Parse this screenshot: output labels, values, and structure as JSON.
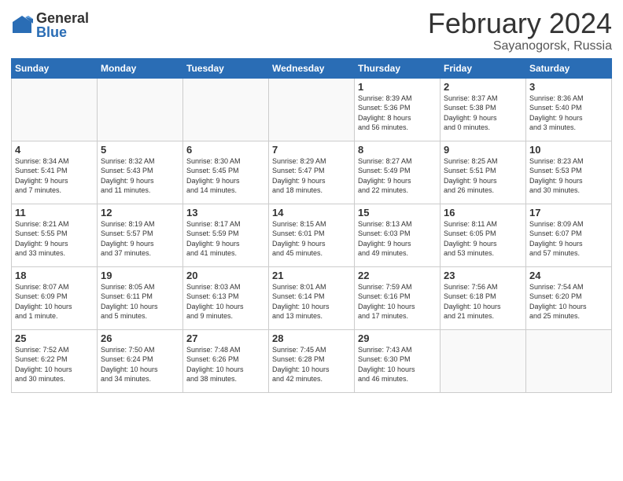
{
  "header": {
    "logo_general": "General",
    "logo_blue": "Blue",
    "title": "February 2024",
    "subtitle": "Sayanogorsk, Russia"
  },
  "days_of_week": [
    "Sunday",
    "Monday",
    "Tuesday",
    "Wednesday",
    "Thursday",
    "Friday",
    "Saturday"
  ],
  "weeks": [
    [
      {
        "day": "",
        "info": ""
      },
      {
        "day": "",
        "info": ""
      },
      {
        "day": "",
        "info": ""
      },
      {
        "day": "",
        "info": ""
      },
      {
        "day": "1",
        "info": "Sunrise: 8:39 AM\nSunset: 5:36 PM\nDaylight: 8 hours\nand 56 minutes."
      },
      {
        "day": "2",
        "info": "Sunrise: 8:37 AM\nSunset: 5:38 PM\nDaylight: 9 hours\nand 0 minutes."
      },
      {
        "day": "3",
        "info": "Sunrise: 8:36 AM\nSunset: 5:40 PM\nDaylight: 9 hours\nand 3 minutes."
      }
    ],
    [
      {
        "day": "4",
        "info": "Sunrise: 8:34 AM\nSunset: 5:41 PM\nDaylight: 9 hours\nand 7 minutes."
      },
      {
        "day": "5",
        "info": "Sunrise: 8:32 AM\nSunset: 5:43 PM\nDaylight: 9 hours\nand 11 minutes."
      },
      {
        "day": "6",
        "info": "Sunrise: 8:30 AM\nSunset: 5:45 PM\nDaylight: 9 hours\nand 14 minutes."
      },
      {
        "day": "7",
        "info": "Sunrise: 8:29 AM\nSunset: 5:47 PM\nDaylight: 9 hours\nand 18 minutes."
      },
      {
        "day": "8",
        "info": "Sunrise: 8:27 AM\nSunset: 5:49 PM\nDaylight: 9 hours\nand 22 minutes."
      },
      {
        "day": "9",
        "info": "Sunrise: 8:25 AM\nSunset: 5:51 PM\nDaylight: 9 hours\nand 26 minutes."
      },
      {
        "day": "10",
        "info": "Sunrise: 8:23 AM\nSunset: 5:53 PM\nDaylight: 9 hours\nand 30 minutes."
      }
    ],
    [
      {
        "day": "11",
        "info": "Sunrise: 8:21 AM\nSunset: 5:55 PM\nDaylight: 9 hours\nand 33 minutes."
      },
      {
        "day": "12",
        "info": "Sunrise: 8:19 AM\nSunset: 5:57 PM\nDaylight: 9 hours\nand 37 minutes."
      },
      {
        "day": "13",
        "info": "Sunrise: 8:17 AM\nSunset: 5:59 PM\nDaylight: 9 hours\nand 41 minutes."
      },
      {
        "day": "14",
        "info": "Sunrise: 8:15 AM\nSunset: 6:01 PM\nDaylight: 9 hours\nand 45 minutes."
      },
      {
        "day": "15",
        "info": "Sunrise: 8:13 AM\nSunset: 6:03 PM\nDaylight: 9 hours\nand 49 minutes."
      },
      {
        "day": "16",
        "info": "Sunrise: 8:11 AM\nSunset: 6:05 PM\nDaylight: 9 hours\nand 53 minutes."
      },
      {
        "day": "17",
        "info": "Sunrise: 8:09 AM\nSunset: 6:07 PM\nDaylight: 9 hours\nand 57 minutes."
      }
    ],
    [
      {
        "day": "18",
        "info": "Sunrise: 8:07 AM\nSunset: 6:09 PM\nDaylight: 10 hours\nand 1 minute."
      },
      {
        "day": "19",
        "info": "Sunrise: 8:05 AM\nSunset: 6:11 PM\nDaylight: 10 hours\nand 5 minutes."
      },
      {
        "day": "20",
        "info": "Sunrise: 8:03 AM\nSunset: 6:13 PM\nDaylight: 10 hours\nand 9 minutes."
      },
      {
        "day": "21",
        "info": "Sunrise: 8:01 AM\nSunset: 6:14 PM\nDaylight: 10 hours\nand 13 minutes."
      },
      {
        "day": "22",
        "info": "Sunrise: 7:59 AM\nSunset: 6:16 PM\nDaylight: 10 hours\nand 17 minutes."
      },
      {
        "day": "23",
        "info": "Sunrise: 7:56 AM\nSunset: 6:18 PM\nDaylight: 10 hours\nand 21 minutes."
      },
      {
        "day": "24",
        "info": "Sunrise: 7:54 AM\nSunset: 6:20 PM\nDaylight: 10 hours\nand 25 minutes."
      }
    ],
    [
      {
        "day": "25",
        "info": "Sunrise: 7:52 AM\nSunset: 6:22 PM\nDaylight: 10 hours\nand 30 minutes."
      },
      {
        "day": "26",
        "info": "Sunrise: 7:50 AM\nSunset: 6:24 PM\nDaylight: 10 hours\nand 34 minutes."
      },
      {
        "day": "27",
        "info": "Sunrise: 7:48 AM\nSunset: 6:26 PM\nDaylight: 10 hours\nand 38 minutes."
      },
      {
        "day": "28",
        "info": "Sunrise: 7:45 AM\nSunset: 6:28 PM\nDaylight: 10 hours\nand 42 minutes."
      },
      {
        "day": "29",
        "info": "Sunrise: 7:43 AM\nSunset: 6:30 PM\nDaylight: 10 hours\nand 46 minutes."
      },
      {
        "day": "",
        "info": ""
      },
      {
        "day": "",
        "info": ""
      }
    ]
  ]
}
